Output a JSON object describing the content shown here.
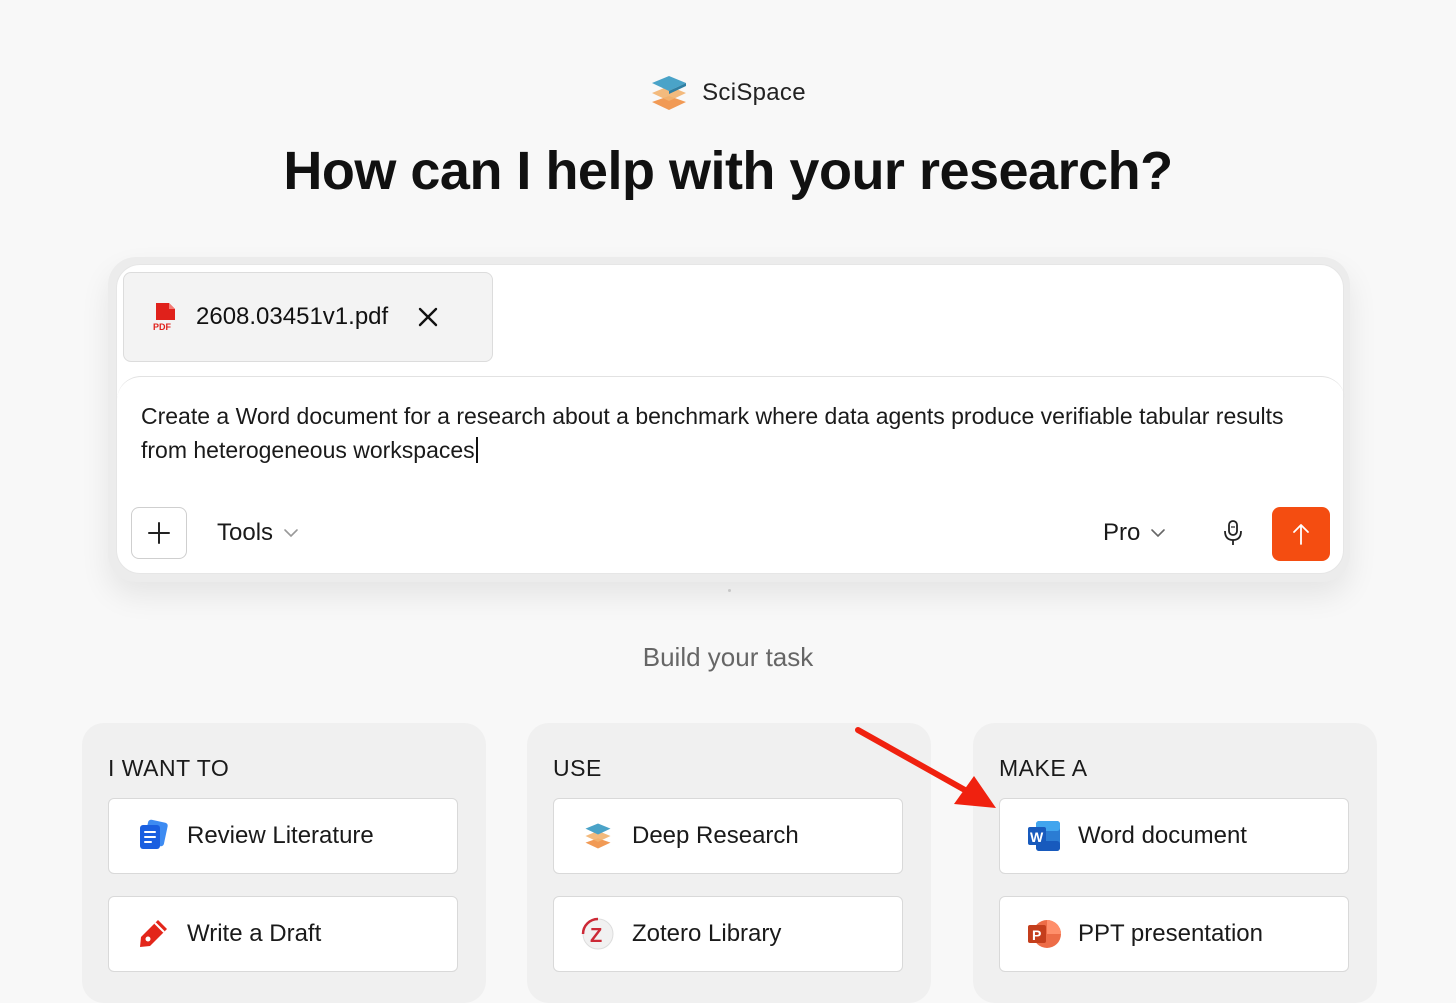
{
  "brand": {
    "name": "SciSpace"
  },
  "headline": "How can I help with your research?",
  "composer": {
    "attachment": {
      "file_name": "2608.03451v1.pdf",
      "file_type": "PDF"
    },
    "prompt_text": "Create a Word document for a research about a benchmark where data agents produce verifiable tabular results from heterogeneous workspaces",
    "tools_label": "Tools",
    "model_label": "Pro",
    "send_color": "#f44d11"
  },
  "section_title": "Build your task",
  "cards": [
    {
      "title": "I WANT TO",
      "options": [
        {
          "label": "Review Literature",
          "icon": "review-literature-icon"
        },
        {
          "label": "Write a Draft",
          "icon": "pen-icon"
        }
      ]
    },
    {
      "title": "USE",
      "options": [
        {
          "label": "Deep Research",
          "icon": "scispace-logo-icon"
        },
        {
          "label": "Zotero Library",
          "icon": "zotero-icon"
        }
      ]
    },
    {
      "title": "MAKE A",
      "options": [
        {
          "label": "Word document",
          "icon": "word-icon"
        },
        {
          "label": "PPT presentation",
          "icon": "powerpoint-icon"
        }
      ]
    }
  ],
  "annotation": {
    "color": "#f0210f",
    "target": "Word document"
  }
}
